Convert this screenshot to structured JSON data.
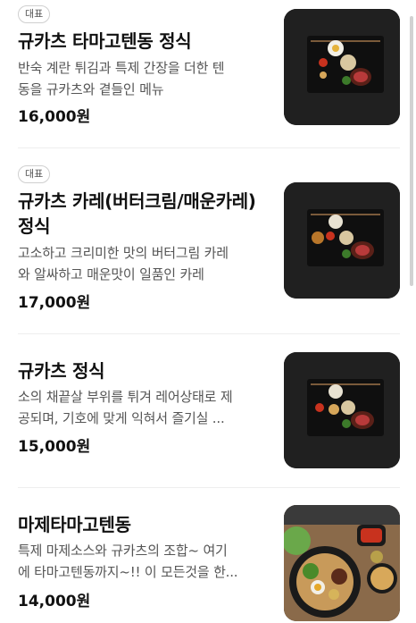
{
  "menu": {
    "items": [
      {
        "badge": "대표",
        "title": "규카츠 타마고텐동 정식",
        "desc_lines": [
          "반숙 계란 튀김과 특제 간장을 더한 텐",
          "동을 규카츠와 곁들인 메뉴"
        ],
        "price": "16,000원",
        "image": "gyukatsu-tamago-tendon-set-photo"
      },
      {
        "badge": "대표",
        "title_lines": [
          "규카츠 카레(버터크림/매운카레)",
          "정식"
        ],
        "desc_lines": [
          "고소하고 크리미한 맛의 버터그림 카레",
          "와 알싸하고 매운맛이 일품인 카레"
        ],
        "price": "17,000원",
        "image": "gyukatsu-curry-set-photo"
      },
      {
        "title": "규카츠 정식",
        "desc_lines": [
          "소의 채끝살 부위를 튀겨 레어상태로 제",
          "공되며, 기호에 맞게 익혀서 즐기실 ..."
        ],
        "price": "15,000원",
        "image": "gyukatsu-set-photo"
      },
      {
        "title": "마제타마고텐동",
        "desc_lines": [
          "특제 마제소스와 규카츠의 조합~ 여기",
          "에 타마고텐동까지~!! 이 모든것을 한..."
        ],
        "price": "14,000원",
        "image": "maze-tamago-tendon-photo"
      }
    ]
  }
}
